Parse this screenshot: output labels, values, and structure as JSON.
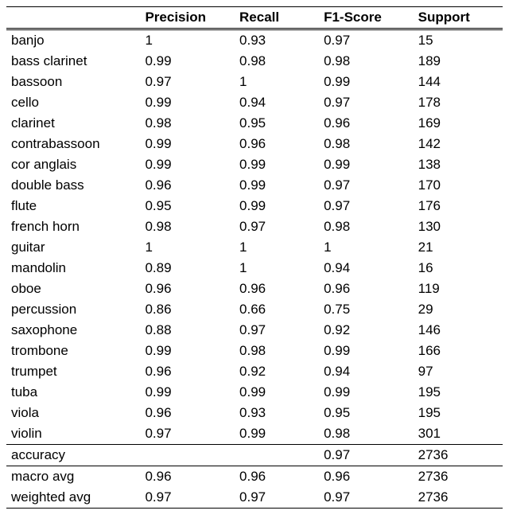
{
  "chart_data": {
    "type": "table",
    "columns": [
      "",
      "Precision",
      "Recall",
      "F1-Score",
      "Support"
    ],
    "rows": [
      {
        "label": "banjo",
        "precision": "1",
        "recall": "0.93",
        "f1": "0.97",
        "support": "15"
      },
      {
        "label": "bass clarinet",
        "precision": "0.99",
        "recall": "0.98",
        "f1": "0.98",
        "support": "189"
      },
      {
        "label": "bassoon",
        "precision": "0.97",
        "recall": "1",
        "f1": "0.99",
        "support": "144"
      },
      {
        "label": "cello",
        "precision": "0.99",
        "recall": "0.94",
        "f1": "0.97",
        "support": "178"
      },
      {
        "label": "clarinet",
        "precision": "0.98",
        "recall": "0.95",
        "f1": "0.96",
        "support": "169"
      },
      {
        "label": "contrabassoon",
        "precision": "0.99",
        "recall": "0.96",
        "f1": "0.98",
        "support": "142"
      },
      {
        "label": "cor anglais",
        "precision": "0.99",
        "recall": "0.99",
        "f1": "0.99",
        "support": "138"
      },
      {
        "label": "double bass",
        "precision": "0.96",
        "recall": "0.99",
        "f1": "0.97",
        "support": "170"
      },
      {
        "label": "flute",
        "precision": "0.95",
        "recall": "0.99",
        "f1": "0.97",
        "support": "176"
      },
      {
        "label": "french horn",
        "precision": "0.98",
        "recall": "0.97",
        "f1": "0.98",
        "support": "130"
      },
      {
        "label": "guitar",
        "precision": "1",
        "recall": "1",
        "f1": "1",
        "support": "21"
      },
      {
        "label": "mandolin",
        "precision": "0.89",
        "recall": "1",
        "f1": "0.94",
        "support": "16"
      },
      {
        "label": "oboe",
        "precision": "0.96",
        "recall": "0.96",
        "f1": "0.96",
        "support": "119"
      },
      {
        "label": "percussion",
        "precision": "0.86",
        "recall": "0.66",
        "f1": "0.75",
        "support": "29"
      },
      {
        "label": "saxophone",
        "precision": "0.88",
        "recall": "0.97",
        "f1": "0.92",
        "support": "146"
      },
      {
        "label": "trombone",
        "precision": "0.99",
        "recall": "0.98",
        "f1": "0.99",
        "support": "166"
      },
      {
        "label": "trumpet",
        "precision": "0.96",
        "recall": "0.92",
        "f1": "0.94",
        "support": "97"
      },
      {
        "label": "tuba",
        "precision": "0.99",
        "recall": "0.99",
        "f1": "0.99",
        "support": "195"
      },
      {
        "label": "viola",
        "precision": "0.96",
        "recall": "0.93",
        "f1": "0.95",
        "support": "195"
      },
      {
        "label": "violin",
        "precision": "0.97",
        "recall": "0.99",
        "f1": "0.98",
        "support": "301"
      }
    ],
    "summary": [
      {
        "label": "accuracy",
        "precision": "",
        "recall": "",
        "f1": "0.97",
        "support": "2736"
      },
      {
        "label": "macro avg",
        "precision": "0.96",
        "recall": "0.96",
        "f1": "0.96",
        "support": "2736"
      },
      {
        "label": "weighted avg",
        "precision": "0.97",
        "recall": "0.97",
        "f1": "0.97",
        "support": "2736"
      }
    ]
  }
}
